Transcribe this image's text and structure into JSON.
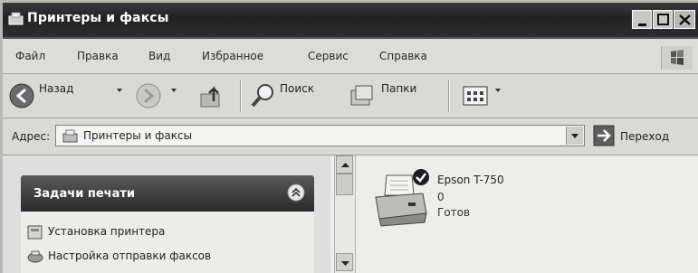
{
  "window": {
    "title": "Принтеры и факсы"
  },
  "menu": {
    "items": [
      "Файл",
      "Правка",
      "Вид",
      "Избранное",
      "Сервис",
      "Справка"
    ]
  },
  "toolbar": {
    "back_label": "Назад",
    "search_label": "Поиск",
    "folders_label": "Папки"
  },
  "address": {
    "label": "Адрес:",
    "value": "Принтеры и факсы",
    "go_label": "Переход"
  },
  "tasks": {
    "header": "Задачи печати",
    "items": [
      {
        "label": "Установка принтера",
        "icon": "add-printer-icon"
      },
      {
        "label": "Настройка отправки факсов",
        "icon": "fax-setup-icon"
      }
    ]
  },
  "printer": {
    "name": "Epson T-750",
    "documents": "0",
    "status": "Готов",
    "icon": "printer-icon",
    "default_badge": "checkmark-icon"
  }
}
